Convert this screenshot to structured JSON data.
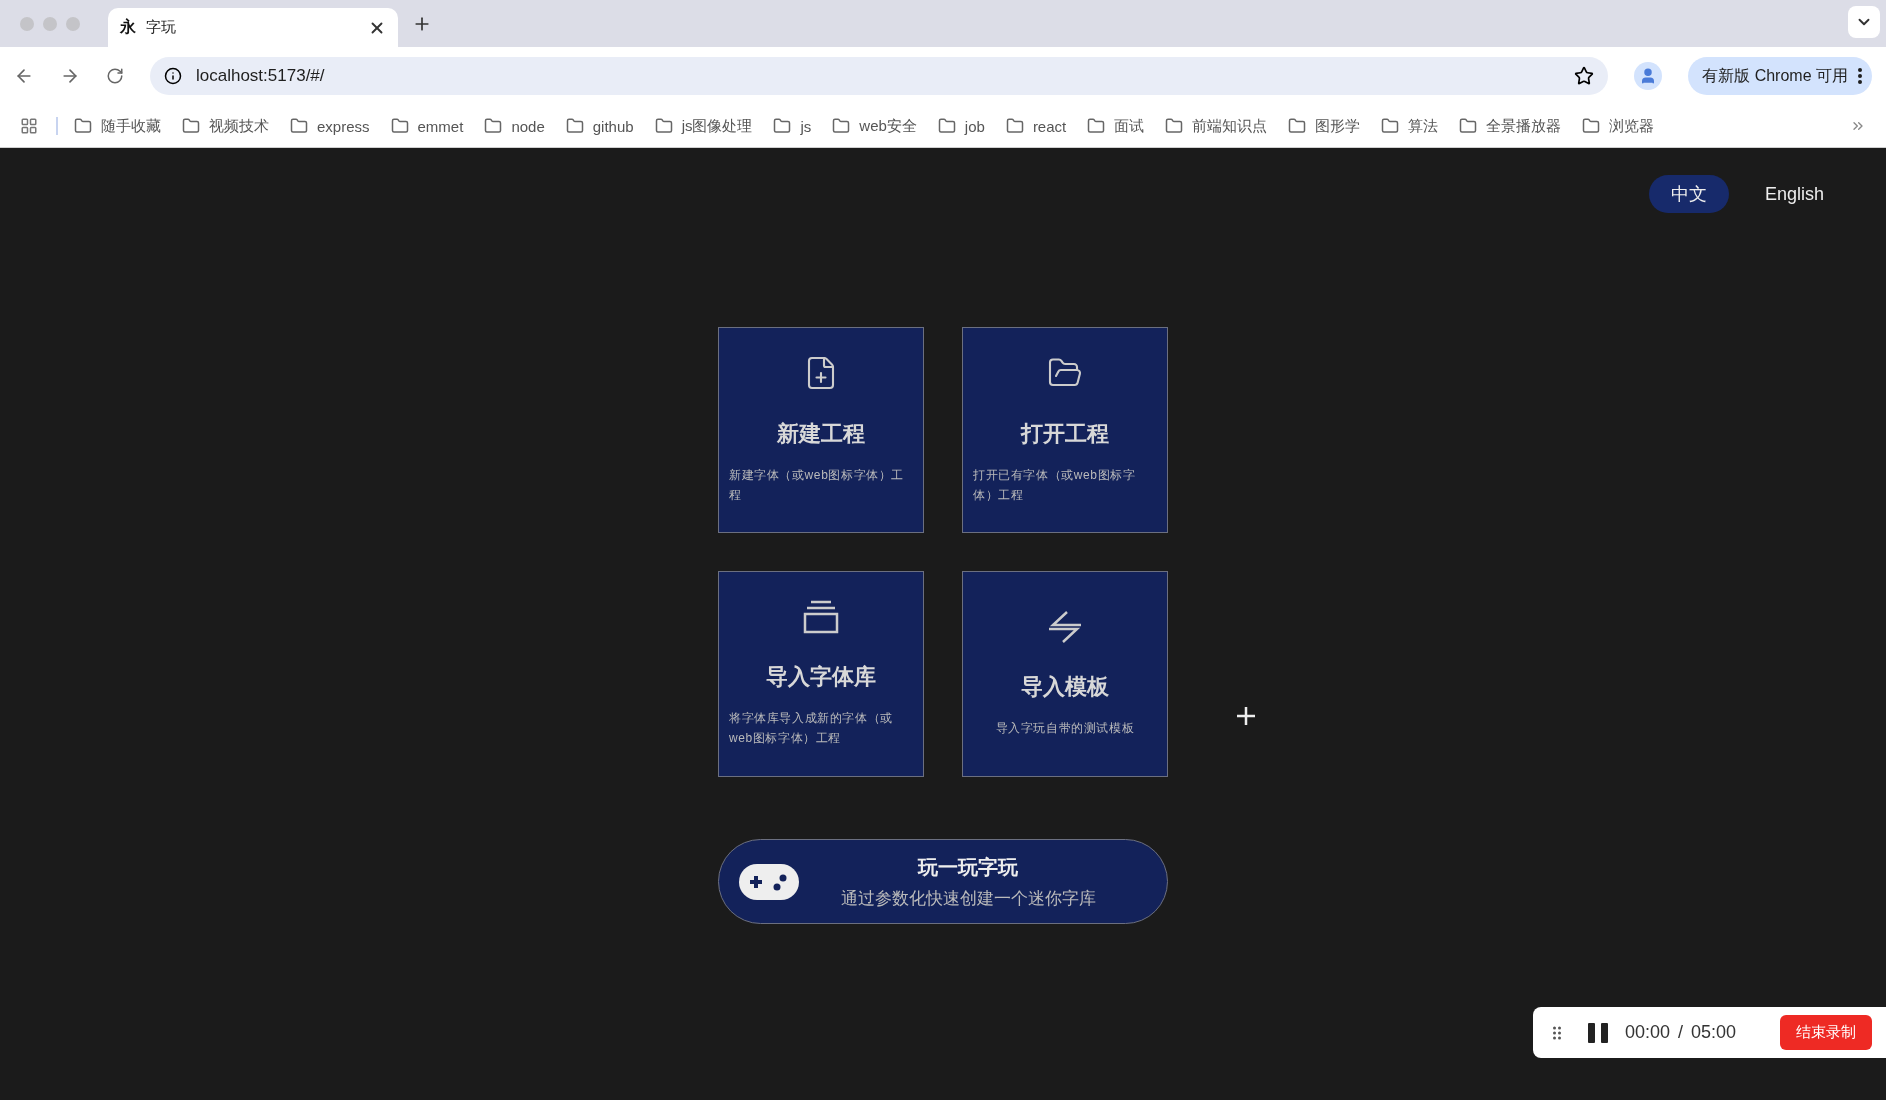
{
  "browser": {
    "tab": {
      "favicon": "永",
      "title": "字玩"
    },
    "url": "localhost:5173/#/",
    "update_button": "有新版 Chrome 可用",
    "bookmarks": [
      "随手收藏",
      "视频技术",
      "express",
      "emmet",
      "node",
      "github",
      "js图像处理",
      "js",
      "web安全",
      "job",
      "react",
      "面试",
      "前端知识点",
      "图形学",
      "算法",
      "全景播放器",
      "浏览器"
    ]
  },
  "languages": [
    {
      "label": "中文",
      "selected": true
    },
    {
      "label": "English",
      "selected": false
    }
  ],
  "cards": [
    {
      "title": "新建工程",
      "description": "新建字体（或web图标字体）工程"
    },
    {
      "title": "打开工程",
      "description": "打开已有字体（或web图标字体）工程"
    },
    {
      "title": "导入字体库",
      "description": "将字体库导入成新的字体（或web图标字体）工程"
    },
    {
      "title": "导入模板",
      "description": "导入字玩自带的测试模板"
    }
  ],
  "play": {
    "title": "玩一玩字玩",
    "subtitle": "通过参数化快速创建一个迷你字库"
  },
  "recorder": {
    "elapsed": "00:00",
    "separator": "/",
    "total": "05:00",
    "stop_button": "结束录制"
  }
}
